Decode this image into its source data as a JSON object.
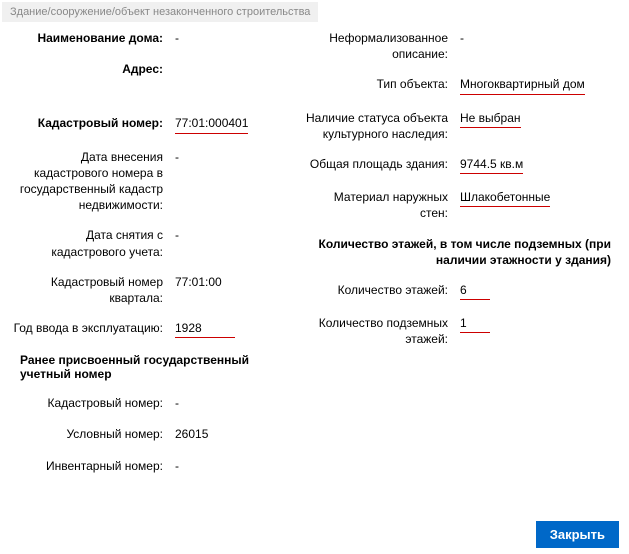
{
  "breadcrumb": "Здание/сооружение/объект незаконченного строительства",
  "left": {
    "name_label": "Наименование дома:",
    "name_value": "-",
    "addr_label": "Адрес:",
    "addr_value": "",
    "cad_label": "Кадастровый номер:",
    "cad_value": "77:01:000401",
    "date_in_label": "Дата внесения кадастрового номера в государственный кадастр недвижимости:",
    "date_in_value": "-",
    "date_off_label": "Дата снятия с кадастрового учета:",
    "date_off_value": "-",
    "block_label": "Кадастровый номер квартала:",
    "block_value": "77:01:00",
    "year_label": "Год ввода в эксплуатацию:",
    "year_value": "1928"
  },
  "prev_section": "Ранее присвоенный государственный учетный номер",
  "prev": {
    "cad_label": "Кадастровый номер:",
    "cad_value": "-",
    "cond_label": "Условный номер:",
    "cond_value": "26015",
    "inv_label": "Инвентарный номер:",
    "inv_value": "-"
  },
  "right": {
    "desc_label": "Неформализованное описание:",
    "desc_value": "-",
    "type_label": "Тип объекта:",
    "type_value": "Многоквартирный дом",
    "heritage_label": "Наличие статуса объекта культурного наследия:",
    "heritage_value": "Не выбран",
    "area_label": "Общая площадь здания:",
    "area_value": "9744.5 кв.м",
    "wall_label": "Материал наружных стен:",
    "wall_value": "Шлакобетонные"
  },
  "floors_section": "Количество этажей, в том числе подземных (при наличии этажности у здания)",
  "floors": {
    "count_label": "Количество этажей:",
    "count_value": "6",
    "under_label": "Количество подземных этажей:",
    "under_value": "1"
  },
  "close_label": "Закрыть"
}
